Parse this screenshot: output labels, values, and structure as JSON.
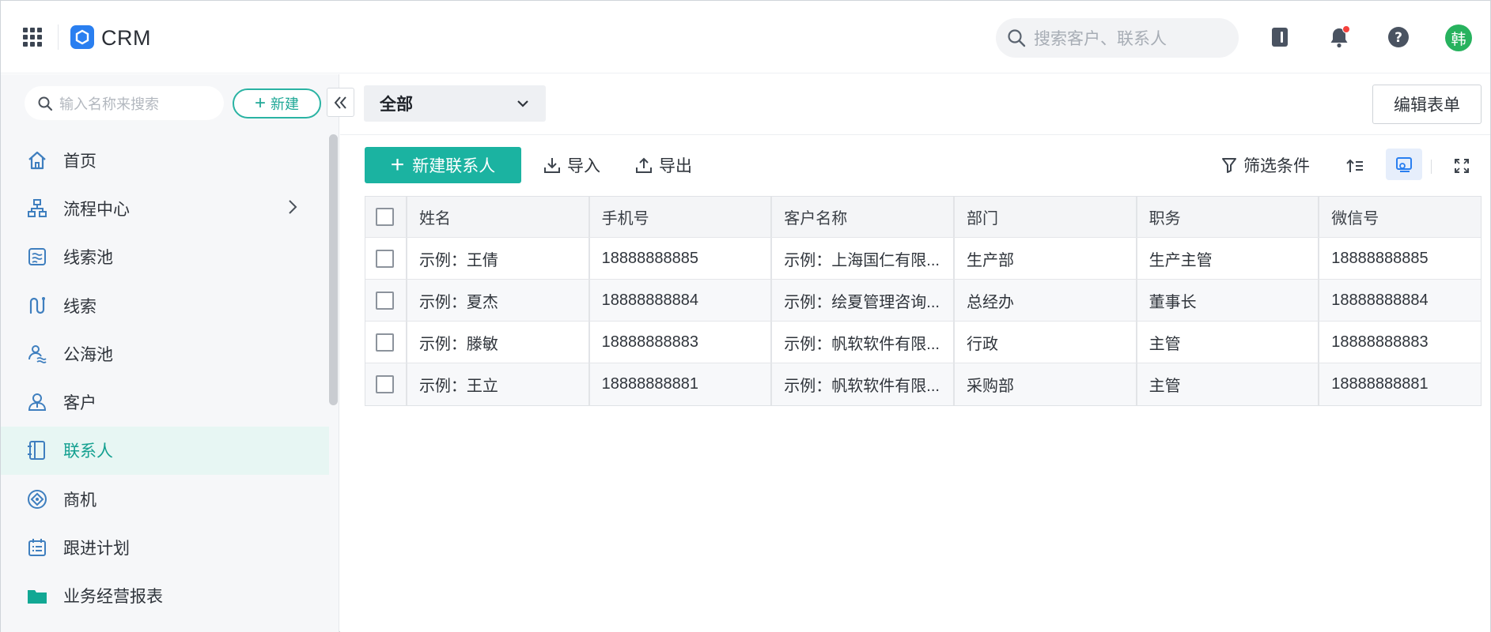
{
  "app": {
    "title": "CRM",
    "brand_color": "#2A7FF0",
    "accent_color": "#1BB3A1"
  },
  "header": {
    "search_placeholder": "搜索客户、联系人",
    "avatar_text": "韩",
    "icons": [
      "apps-grid-icon",
      "contact-book-icon",
      "bell-icon",
      "help-icon"
    ]
  },
  "sidebar": {
    "search_placeholder": "输入名称来搜索",
    "new_button": "新建",
    "items": [
      {
        "label": "首页",
        "icon": "home-icon"
      },
      {
        "label": "流程中心",
        "icon": "flow-icon",
        "has_submenu": true
      },
      {
        "label": "线索池",
        "icon": "lead-pool-icon"
      },
      {
        "label": "线索",
        "icon": "lead-icon"
      },
      {
        "label": "公海池",
        "icon": "public-pool-icon"
      },
      {
        "label": "客户",
        "icon": "customer-icon"
      },
      {
        "label": "联系人",
        "icon": "contact-icon",
        "active": true
      },
      {
        "label": "商机",
        "icon": "opportunity-icon"
      },
      {
        "label": "跟进计划",
        "icon": "plan-icon"
      },
      {
        "label": "业务经营报表",
        "icon": "folder-icon"
      }
    ]
  },
  "main": {
    "view_select": "全部",
    "edit_form_button": "编辑表单",
    "toolbar": {
      "new_contact": "新建联系人",
      "import": "导入",
      "export": "导出",
      "filter": "筛选条件"
    },
    "table": {
      "columns": [
        "姓名",
        "手机号",
        "客户名称",
        "部门",
        "职务",
        "微信号"
      ],
      "rows": [
        [
          "示例：王倩",
          "18888888885",
          "示例：上海国仁有限...",
          "生产部",
          "生产主管",
          "18888888885"
        ],
        [
          "示例：夏杰",
          "18888888884",
          "示例：绘夏管理咨询...",
          "总经办",
          "董事长",
          "18888888884"
        ],
        [
          "示例：滕敏",
          "18888888883",
          "示例：帆软软件有限...",
          "行政",
          "主管",
          "18888888883"
        ],
        [
          "示例：王立",
          "18888888881",
          "示例：帆软软件有限...",
          "采购部",
          "主管",
          "18888888881"
        ]
      ]
    }
  }
}
